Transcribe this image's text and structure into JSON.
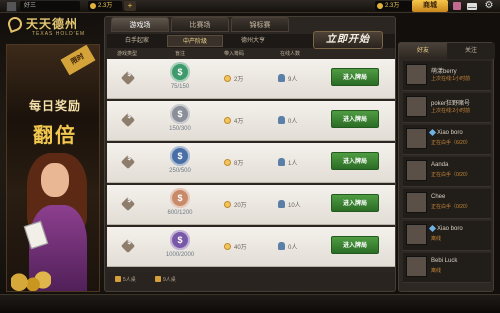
{
  "topbar": {
    "user_name": "好三",
    "coins": "2.3万",
    "plus": "+",
    "gold": "2.3万",
    "mall_label": "商城"
  },
  "logo": {
    "cn": "天天德州",
    "en": "TEXAS HOLD'EM"
  },
  "banner": {
    "tag": "限时",
    "line1": "每日奖励",
    "line2": "翻倍"
  },
  "tabs": [
    {
      "label": "游戏场"
    },
    {
      "label": "比赛场"
    },
    {
      "label": "锦标赛"
    }
  ],
  "subtabs": [
    {
      "label": "白手起家"
    },
    {
      "label": "中产阶级"
    },
    {
      "label": "德州大亨"
    }
  ],
  "quick_start": "立即开始",
  "columns": [
    "游戏类型",
    "盲注",
    "带入筹码",
    "在线人数"
  ],
  "rooms": [
    {
      "chip_value": "$",
      "chip_color": "#3f9a6c",
      "blinds": "75/150",
      "min_coin": "2万",
      "online": "9人",
      "enter_label": "进入牌局"
    },
    {
      "chip_value": "$",
      "chip_color": "#8a8f99",
      "blinds": "150/300",
      "min_coin": "4万",
      "online": "0人",
      "enter_label": "进入牌局"
    },
    {
      "chip_value": "$",
      "chip_color": "#4a6fa6",
      "blinds": "250/500",
      "min_coin": "8万",
      "online": "1人",
      "enter_label": "进入牌局"
    },
    {
      "chip_value": "$",
      "chip_color": "#c98a6a",
      "blinds": "600/1200",
      "min_coin": "20万",
      "online": "10人",
      "enter_label": "进入牌局"
    },
    {
      "chip_value": "$",
      "chip_color": "#7a58a8",
      "blinds": "1000/2000",
      "min_coin": "40万",
      "online": "0人",
      "enter_label": "进入牌局"
    }
  ],
  "legend": [
    {
      "label": "5人桌"
    },
    {
      "label": "9人桌"
    }
  ],
  "side_tabs": [
    {
      "label": "好友"
    },
    {
      "label": "关注"
    }
  ],
  "friends": [
    {
      "name": "萌漾berry",
      "status": "上次在线:1小时前",
      "diamond": false
    },
    {
      "name": "poker狂野赌号",
      "status": "上次在线:2小时前",
      "diamond": false
    },
    {
      "name": "Xiao boro",
      "status": "正在白手（6/20）",
      "diamond": true
    },
    {
      "name": "Aanda",
      "status": "正在白手（0/20）",
      "diamond": false
    },
    {
      "name": "Chee",
      "status": "正在白手（0/20）",
      "diamond": false
    },
    {
      "name": "Xiao boro",
      "status": "离线",
      "diamond": true
    },
    {
      "name": "Bebi Luck",
      "status": "离线",
      "diamond": false
    }
  ]
}
